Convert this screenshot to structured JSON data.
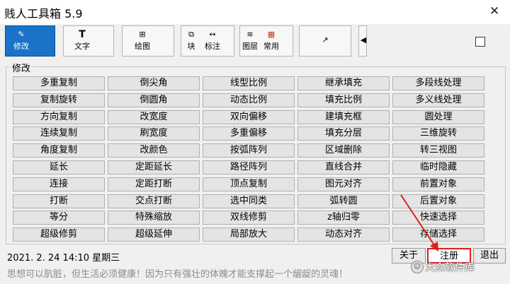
{
  "window": {
    "title": "贱人工具箱 5.9",
    "close_glyph": "✕"
  },
  "toolbar": {
    "buttons": [
      {
        "label": "修改",
        "icon": "✎",
        "active": true
      },
      {
        "label": "文字",
        "icon": "T",
        "active": false
      },
      {
        "label": "绘图",
        "icon": "⊞",
        "active": false
      }
    ],
    "block": {
      "label": "块",
      "icon": "⧉"
    },
    "dim": {
      "label": "标注",
      "icon": "↔"
    },
    "layer": {
      "label": "图层",
      "icon": "≋"
    },
    "common": {
      "label": "常用",
      "icon": "▦"
    },
    "link_icon": "↗",
    "arrow_icon": "◀"
  },
  "group": {
    "title": "修改",
    "buttons": [
      [
        "多重复制",
        "倒尖角",
        "线型比例",
        "继承填充",
        "多段线处理"
      ],
      [
        "复制旋转",
        "倒圆角",
        "动态比例",
        "填充比例",
        "多义线处理"
      ],
      [
        "方向复制",
        "改宽度",
        "双向偏移",
        "建填充框",
        "圆处理"
      ],
      [
        "连续复制",
        "刷宽度",
        "多重偏移",
        "填充分层",
        "三维旋转"
      ],
      [
        "角度复制",
        "改颜色",
        "按弧阵列",
        "区域删除",
        "转三视图"
      ],
      [
        "延长",
        "定距延长",
        "路径阵列",
        "直线合并",
        "临时隐藏"
      ],
      [
        "连接",
        "定距打断",
        "顶点复制",
        "图元对齐",
        "前置对象"
      ],
      [
        "打断",
        "交点打断",
        "选中同类",
        "弧转圆",
        "后置对象"
      ],
      [
        "等分",
        "特殊缩放",
        "双线修剪",
        "z轴归零",
        "快速选择"
      ],
      [
        "超级修剪",
        "超级延伸",
        "局部放大",
        "动态对齐",
        "存储选择"
      ]
    ]
  },
  "status": {
    "datetime": "2021. 2. 24    14:10    星期三",
    "motto": "思想可以肮脏，但生活必须健康！因为只有强壮的体魄才能支撑起一个龌龊的灵魂！",
    "about_label": "关于",
    "register_label": "注册",
    "exit_label": "退出"
  },
  "watermark": {
    "text": "大众软件库",
    "logo": "☺"
  },
  "colors": {
    "active": "#1a73c9",
    "highlight": "#d92020"
  }
}
